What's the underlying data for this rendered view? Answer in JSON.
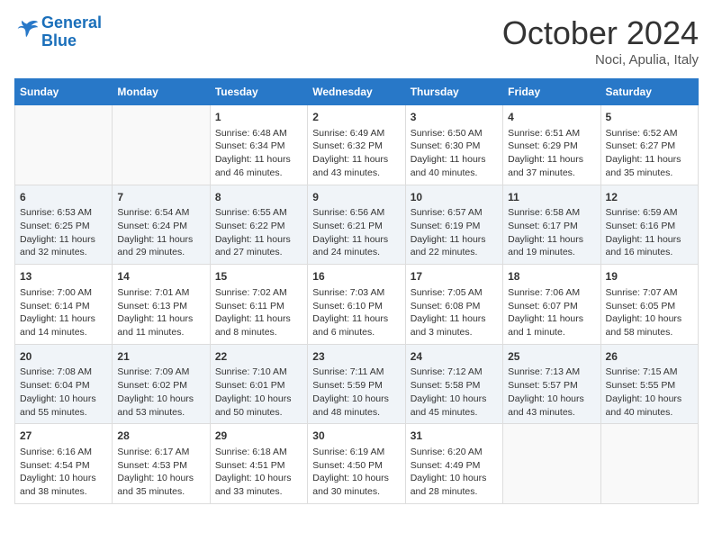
{
  "header": {
    "logo_line1": "General",
    "logo_line2": "Blue",
    "month": "October 2024",
    "location": "Noci, Apulia, Italy"
  },
  "days_of_week": [
    "Sunday",
    "Monday",
    "Tuesday",
    "Wednesday",
    "Thursday",
    "Friday",
    "Saturday"
  ],
  "weeks": [
    [
      {
        "day": "",
        "content": ""
      },
      {
        "day": "",
        "content": ""
      },
      {
        "day": "1",
        "content": "Sunrise: 6:48 AM\nSunset: 6:34 PM\nDaylight: 11 hours and 46 minutes."
      },
      {
        "day": "2",
        "content": "Sunrise: 6:49 AM\nSunset: 6:32 PM\nDaylight: 11 hours and 43 minutes."
      },
      {
        "day": "3",
        "content": "Sunrise: 6:50 AM\nSunset: 6:30 PM\nDaylight: 11 hours and 40 minutes."
      },
      {
        "day": "4",
        "content": "Sunrise: 6:51 AM\nSunset: 6:29 PM\nDaylight: 11 hours and 37 minutes."
      },
      {
        "day": "5",
        "content": "Sunrise: 6:52 AM\nSunset: 6:27 PM\nDaylight: 11 hours and 35 minutes."
      }
    ],
    [
      {
        "day": "6",
        "content": "Sunrise: 6:53 AM\nSunset: 6:25 PM\nDaylight: 11 hours and 32 minutes."
      },
      {
        "day": "7",
        "content": "Sunrise: 6:54 AM\nSunset: 6:24 PM\nDaylight: 11 hours and 29 minutes."
      },
      {
        "day": "8",
        "content": "Sunrise: 6:55 AM\nSunset: 6:22 PM\nDaylight: 11 hours and 27 minutes."
      },
      {
        "day": "9",
        "content": "Sunrise: 6:56 AM\nSunset: 6:21 PM\nDaylight: 11 hours and 24 minutes."
      },
      {
        "day": "10",
        "content": "Sunrise: 6:57 AM\nSunset: 6:19 PM\nDaylight: 11 hours and 22 minutes."
      },
      {
        "day": "11",
        "content": "Sunrise: 6:58 AM\nSunset: 6:17 PM\nDaylight: 11 hours and 19 minutes."
      },
      {
        "day": "12",
        "content": "Sunrise: 6:59 AM\nSunset: 6:16 PM\nDaylight: 11 hours and 16 minutes."
      }
    ],
    [
      {
        "day": "13",
        "content": "Sunrise: 7:00 AM\nSunset: 6:14 PM\nDaylight: 11 hours and 14 minutes."
      },
      {
        "day": "14",
        "content": "Sunrise: 7:01 AM\nSunset: 6:13 PM\nDaylight: 11 hours and 11 minutes."
      },
      {
        "day": "15",
        "content": "Sunrise: 7:02 AM\nSunset: 6:11 PM\nDaylight: 11 hours and 8 minutes."
      },
      {
        "day": "16",
        "content": "Sunrise: 7:03 AM\nSunset: 6:10 PM\nDaylight: 11 hours and 6 minutes."
      },
      {
        "day": "17",
        "content": "Sunrise: 7:05 AM\nSunset: 6:08 PM\nDaylight: 11 hours and 3 minutes."
      },
      {
        "day": "18",
        "content": "Sunrise: 7:06 AM\nSunset: 6:07 PM\nDaylight: 11 hours and 1 minute."
      },
      {
        "day": "19",
        "content": "Sunrise: 7:07 AM\nSunset: 6:05 PM\nDaylight: 10 hours and 58 minutes."
      }
    ],
    [
      {
        "day": "20",
        "content": "Sunrise: 7:08 AM\nSunset: 6:04 PM\nDaylight: 10 hours and 55 minutes."
      },
      {
        "day": "21",
        "content": "Sunrise: 7:09 AM\nSunset: 6:02 PM\nDaylight: 10 hours and 53 minutes."
      },
      {
        "day": "22",
        "content": "Sunrise: 7:10 AM\nSunset: 6:01 PM\nDaylight: 10 hours and 50 minutes."
      },
      {
        "day": "23",
        "content": "Sunrise: 7:11 AM\nSunset: 5:59 PM\nDaylight: 10 hours and 48 minutes."
      },
      {
        "day": "24",
        "content": "Sunrise: 7:12 AM\nSunset: 5:58 PM\nDaylight: 10 hours and 45 minutes."
      },
      {
        "day": "25",
        "content": "Sunrise: 7:13 AM\nSunset: 5:57 PM\nDaylight: 10 hours and 43 minutes."
      },
      {
        "day": "26",
        "content": "Sunrise: 7:15 AM\nSunset: 5:55 PM\nDaylight: 10 hours and 40 minutes."
      }
    ],
    [
      {
        "day": "27",
        "content": "Sunrise: 6:16 AM\nSunset: 4:54 PM\nDaylight: 10 hours and 38 minutes."
      },
      {
        "day": "28",
        "content": "Sunrise: 6:17 AM\nSunset: 4:53 PM\nDaylight: 10 hours and 35 minutes."
      },
      {
        "day": "29",
        "content": "Sunrise: 6:18 AM\nSunset: 4:51 PM\nDaylight: 10 hours and 33 minutes."
      },
      {
        "day": "30",
        "content": "Sunrise: 6:19 AM\nSunset: 4:50 PM\nDaylight: 10 hours and 30 minutes."
      },
      {
        "day": "31",
        "content": "Sunrise: 6:20 AM\nSunset: 4:49 PM\nDaylight: 10 hours and 28 minutes."
      },
      {
        "day": "",
        "content": ""
      },
      {
        "day": "",
        "content": ""
      }
    ]
  ]
}
